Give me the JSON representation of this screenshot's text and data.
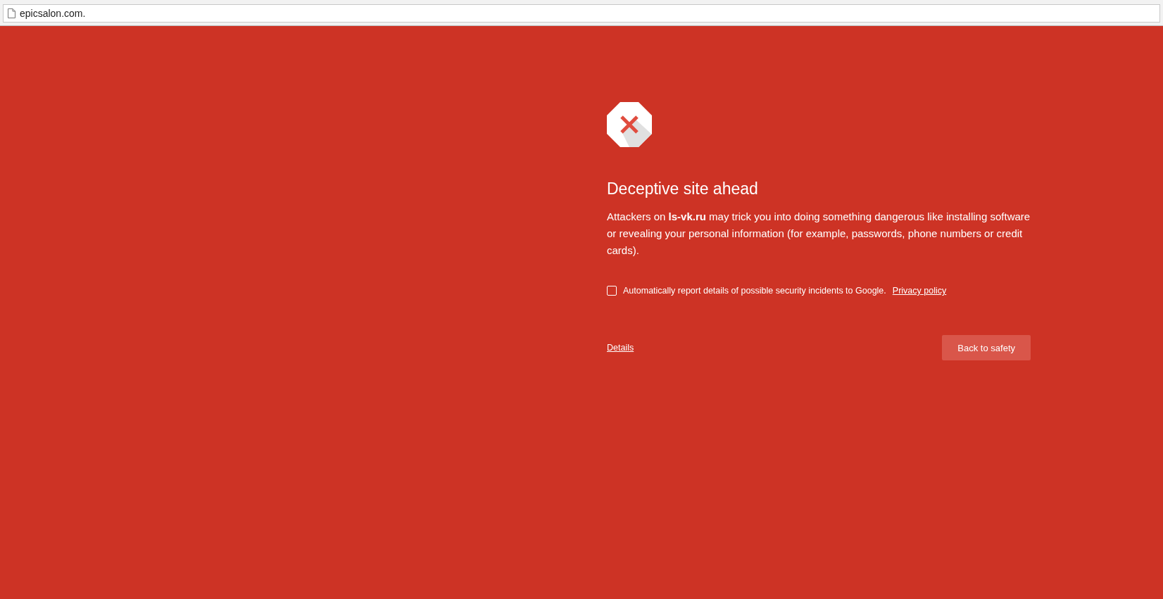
{
  "address_bar": {
    "url": "epicsalon.com."
  },
  "warning": {
    "title": "Deceptive site ahead",
    "message": "Attackers on **ls-vk.ru** may trick you into doing something dangerous like installing software or revealing your personal information (for example, passwords, phone numbers or credit cards).",
    "report_checkbox": {
      "label": "Automatically report details of possible security incidents to Google.",
      "checked": false,
      "link": "Privacy policy"
    },
    "details_link": "Details",
    "button": "Back to safety"
  }
}
